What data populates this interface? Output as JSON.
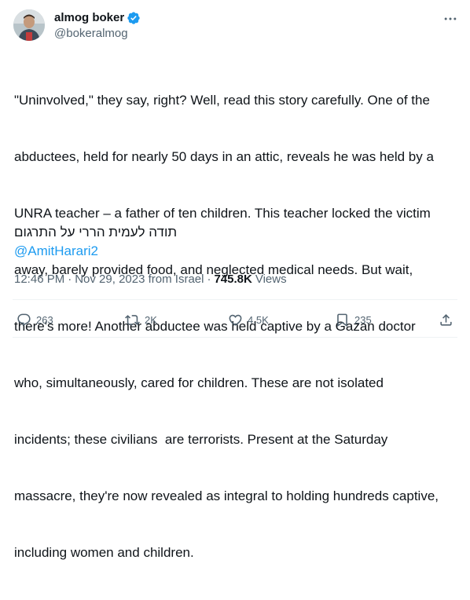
{
  "author": {
    "display_name": "almog boker",
    "handle": "@bokeralmog",
    "verified": true,
    "avatar_icon": "avatar-photo"
  },
  "tweet": {
    "text_lines": [
      "\"Uninvolved,\" they say, right? Well, read this story carefully. One of the",
      "abductees, held for nearly 50 days in an attic, reveals he was held by a",
      "UNRA teacher – a father of ten children. This teacher locked the victim",
      "away, barely provided food, and neglected medical needs. But wait,",
      "there's more! Another abductee was held captive by a Gazan doctor",
      "who, simultaneously, cared for children. These are not isolated",
      "incidents; these civilians  are terrorists. Present at the Saturday",
      "massacre, they're now revealed as integral to holding hundreds captive,",
      "including women and children."
    ],
    "hebrew_line": "תודה לעמית הררי על התרגום",
    "mention": "@AmitHarari2"
  },
  "meta": {
    "time": "12:46 PM",
    "date": "Nov 29, 2023 from Israel",
    "views_count": "745.8K",
    "views_label": "Views",
    "separator": "·"
  },
  "actions": {
    "replies": "263",
    "reposts": "2K",
    "likes": "4.5K",
    "bookmarks": "235"
  },
  "colors": {
    "accent": "#1d9bf0",
    "text": "#0f1419",
    "secondary": "#536471",
    "divider": "#eff3f4"
  }
}
